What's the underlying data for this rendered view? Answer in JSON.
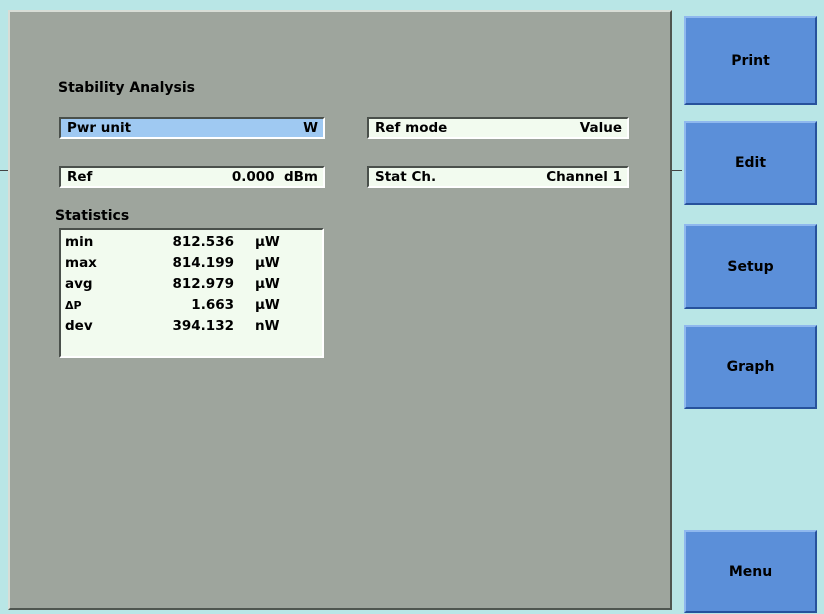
{
  "title": "Stability Analysis",
  "fields": {
    "pwr_unit": {
      "label": "Pwr unit",
      "value": "W"
    },
    "ref_mode": {
      "label": "Ref mode",
      "value": "Value"
    },
    "ref": {
      "label": "Ref",
      "value": "0.000",
      "unit": "dBm"
    },
    "stat_ch": {
      "label": "Stat Ch.",
      "value": "Channel 1"
    }
  },
  "statistics": {
    "heading": "Statistics",
    "rows": [
      {
        "label": "min",
        "value": "812.536",
        "unit": "µW"
      },
      {
        "label": "max",
        "value": "814.199",
        "unit": "µW"
      },
      {
        "label": "avg",
        "value": "812.979",
        "unit": "µW"
      },
      {
        "label": "ΔP",
        "value": "1.663",
        "unit": "µW"
      },
      {
        "label": "dev",
        "value": "394.132",
        "unit": "nW"
      }
    ]
  },
  "softkeys": {
    "print": "Print",
    "edit": "Edit",
    "setup": "Setup",
    "graph": "Graph",
    "menu": "Menu"
  }
}
